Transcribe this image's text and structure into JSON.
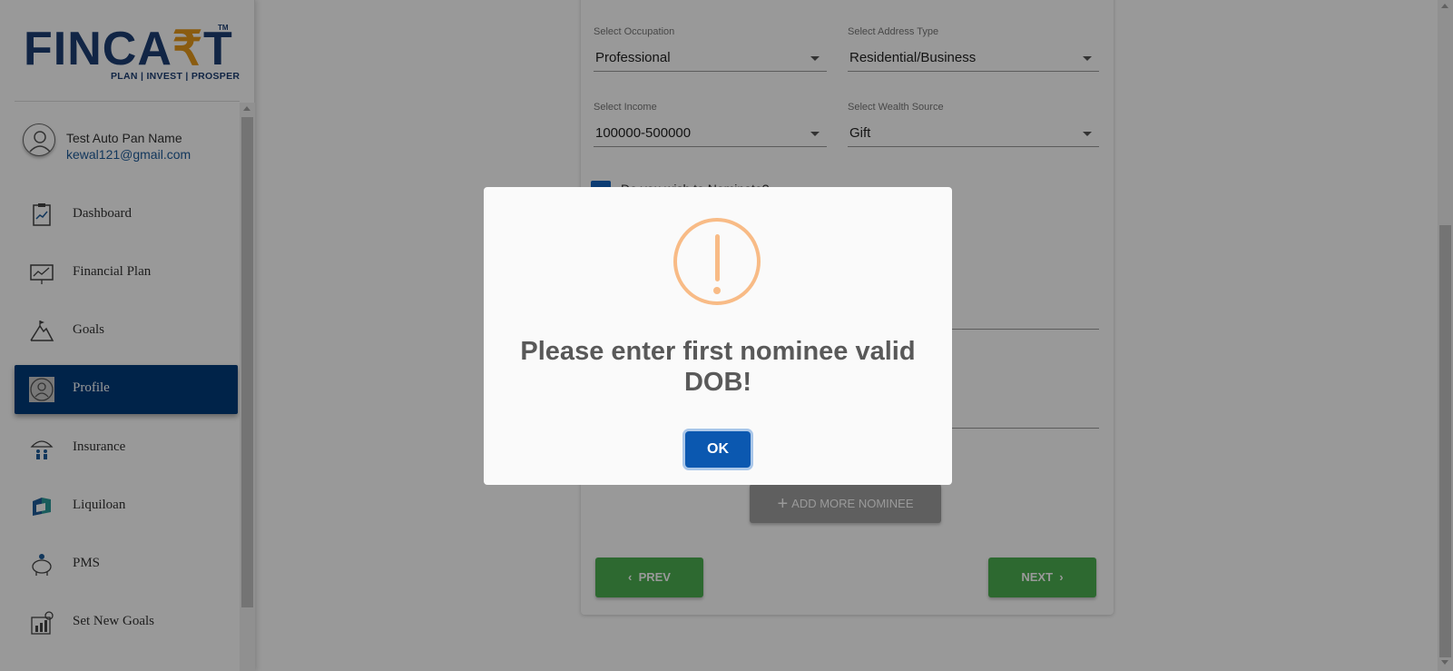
{
  "brand": {
    "name_part1": "FINCA",
    "name_rupee": "₹",
    "name_part2": "T",
    "trademark": "TM",
    "tagline": "PLAN | INVEST | PROSPER"
  },
  "user": {
    "name": "Test Auto Pan Name",
    "email": "kewal121@gmail.com"
  },
  "sidebar": {
    "items": [
      {
        "label": "Dashboard",
        "icon": "dashboard-icon",
        "active": false
      },
      {
        "label": "Financial Plan",
        "icon": "chart-board-icon",
        "active": false
      },
      {
        "label": "Goals",
        "icon": "mountain-flag-icon",
        "active": false
      },
      {
        "label": "Profile",
        "icon": "user-icon",
        "active": true
      },
      {
        "label": "Insurance",
        "icon": "umbrella-family-icon",
        "active": false
      },
      {
        "label": "Liquiloan",
        "icon": "liquiloan-icon",
        "active": false
      },
      {
        "label": "PMS",
        "icon": "piggy-bank-icon",
        "active": false
      },
      {
        "label": "Set New Goals",
        "icon": "target-chart-icon",
        "active": false
      }
    ]
  },
  "form": {
    "occupation": {
      "label": "Select Occupation",
      "value": "Professional"
    },
    "address_type": {
      "label": "Select Address Type",
      "value": "Residential/Business"
    },
    "income": {
      "label": "Select Income",
      "value": "100000-500000"
    },
    "wealth_source": {
      "label": "Select Wealth Source",
      "value": "Gift"
    },
    "nominate_label": "Do you wish to Nominate?",
    "nominate_checked": true,
    "add_nominee_label": "ADD MORE NOMINEE",
    "prev_label": "PREV",
    "next_label": "NEXT"
  },
  "dialog": {
    "message": "Please enter first nominee valid DOB!",
    "ok_label": "OK",
    "icon": "warning-icon"
  },
  "colors": {
    "sidebar_active": "#003b7a",
    "primary_button": "#4caf50",
    "dialog_ok": "#0b58b0",
    "warning": "#f8bb86",
    "brand_blue": "#1d3f73",
    "brand_orange": "#e69a1c"
  }
}
